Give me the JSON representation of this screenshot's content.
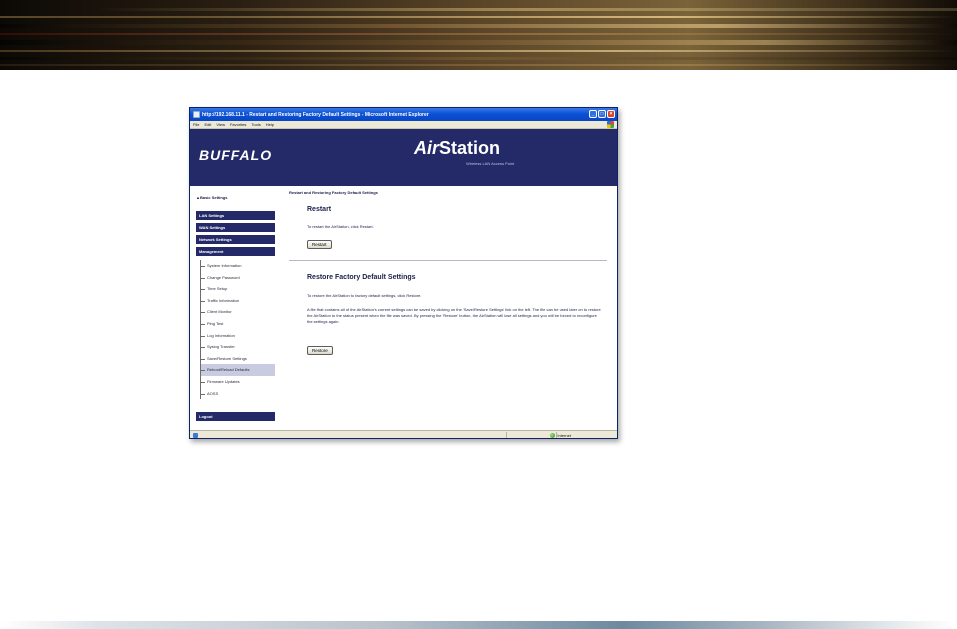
{
  "window": {
    "title": "http://192.168.11.1 - Restart and Restoring Factory Default Settings - Microsoft Internet Explorer",
    "menu": [
      "File",
      "Edit",
      "View",
      "Favorites",
      "Tools",
      "Help"
    ],
    "controls": {
      "minimize": "_",
      "maximize": "□",
      "close": "×"
    }
  },
  "header": {
    "brand": "BUFFALO",
    "product_prefix": "Air",
    "product_suffix": "Station",
    "tagline": "Wireless LAN Access Point"
  },
  "sidebar": {
    "basic_settings": "▲Basic Settings",
    "blocks": [
      "LAN Settings",
      "WAN Settings",
      "Network Settings",
      "Management"
    ],
    "management_items": [
      "System Information",
      "Change Password",
      "Time Setup",
      "Traffic Information",
      "Client Monitor",
      "Ping Test",
      "Log Information",
      "Syslog Transfer",
      "Save/Restore Settings",
      "Reboot/Reload Defaults",
      "Firmware Updates",
      "AOSS"
    ],
    "active_item_index": 9,
    "logout": "Logout"
  },
  "main": {
    "breadcrumb": "Restart and Restoring Factory Default Settings",
    "restart": {
      "heading": "Restart",
      "description": "To restart the AirStation, click Restart.",
      "button": "Restart"
    },
    "restore": {
      "heading": "Restore Factory Default Settings",
      "description": "To restore the AirStation to factory default settings, click Restore.",
      "note": "A file that contains all of the AirStation's current settings can be saved by clicking on the 'Save/Restore Settings' link on the left. The file can be used later on to restore the AirStation to the status present when the file was saved. By pressing the 'Restore' button, the AirStation will lose all settings and you will be forced to reconfigure the settings again.",
      "button": "Restore"
    }
  },
  "statusbar": {
    "zone": "Internet"
  },
  "colors": {
    "nav_bg": "#232a67",
    "active_item_bg": "#c9cbe0",
    "titlebar": "#0a52d6"
  }
}
